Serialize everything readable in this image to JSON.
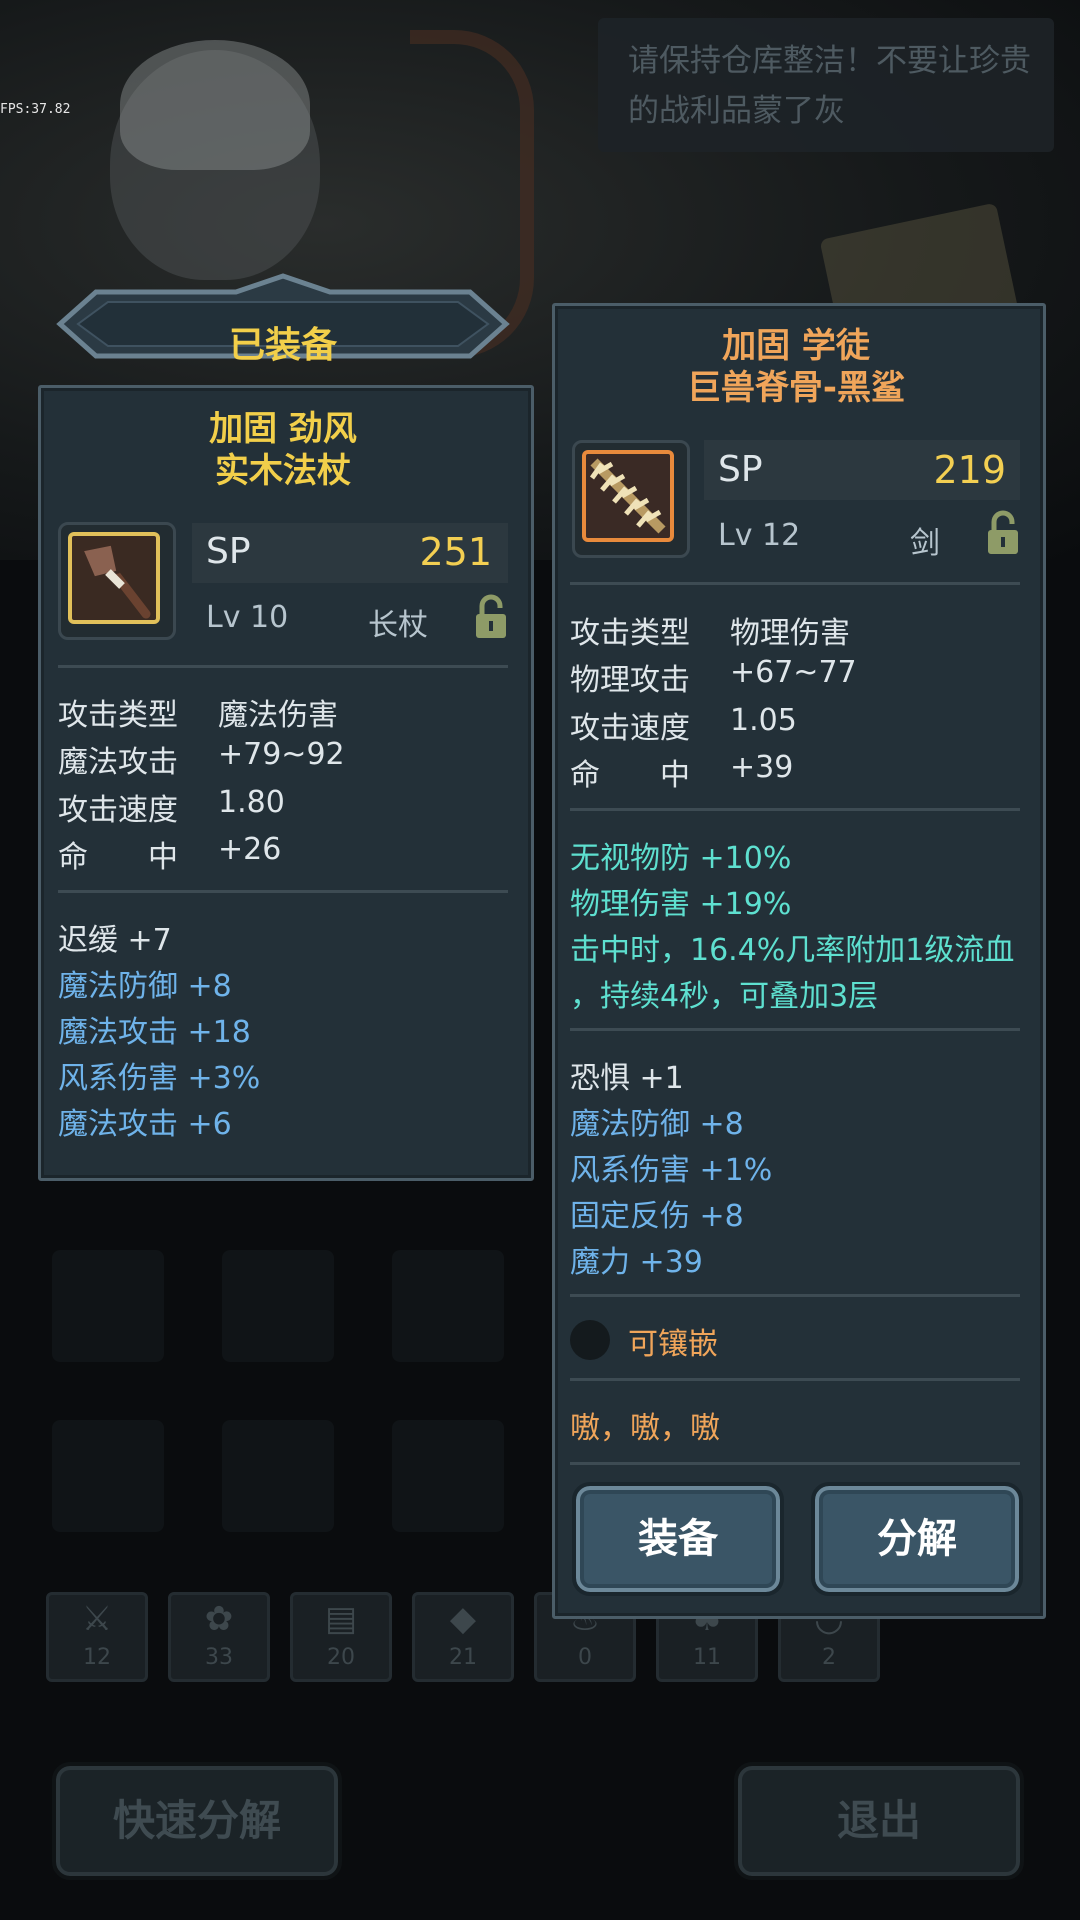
{
  "fps": "FPS:37.82",
  "speech": "请保持仓库整洁！不要让珍贵的战利品蒙了灰",
  "equipped": {
    "banner": "已装备",
    "name_line1": "加固 劲风",
    "name_line2": "实木法杖",
    "sp_label": "SP",
    "sp_value": "251",
    "level": "Lv 10",
    "weapon_type": "长杖",
    "icon": "staff-icon",
    "stats": [
      {
        "label": "攻击类型",
        "value": "魔法伤害"
      },
      {
        "label": "魔法攻击",
        "value": "+79~92"
      },
      {
        "label": "攻击速度",
        "value": "1.80"
      },
      {
        "label": "命　　中",
        "value": "+26"
      }
    ],
    "bonuses": [
      {
        "text": "迟缓 +7",
        "color": "white"
      },
      {
        "text": "魔法防御 +8",
        "color": "blue"
      },
      {
        "text": "魔法攻击 +18",
        "color": "blue"
      },
      {
        "text": "风系伤害 +3%",
        "color": "blue"
      },
      {
        "text": "魔法攻击 +6",
        "color": "blue"
      }
    ]
  },
  "candidate": {
    "name_line1": "加固 学徒",
    "name_line2": "巨兽脊骨-黑鲨",
    "sp_label": "SP",
    "sp_value": "219",
    "level": "Lv 12",
    "weapon_type": "剑",
    "icon": "spine-sword-icon",
    "stats": [
      {
        "label": "攻击类型",
        "value": "物理伤害"
      },
      {
        "label": "物理攻击",
        "value": "+67~77"
      },
      {
        "label": "攻击速度",
        "value": "1.05"
      },
      {
        "label": "命　　中",
        "value": "+39"
      }
    ],
    "special": [
      "无视物防 +10%",
      "物理伤害 +19%",
      "击中时，16.4%几率附加1级流血",
      "，持续4秒，可叠加3层"
    ],
    "bonuses": [
      {
        "text": "恐惧 +1",
        "color": "white"
      },
      {
        "text": "魔法防御 +8",
        "color": "blue"
      },
      {
        "text": "风系伤害 +1%",
        "color": "blue"
      },
      {
        "text": "固定反伤 +8",
        "color": "blue"
      },
      {
        "text": "魔力 +39",
        "color": "blue"
      }
    ],
    "socket_label": "可镶嵌",
    "flavor": "嗷，嗷，嗷",
    "equip_button": "装备",
    "dismantle_button": "分解"
  },
  "tabs": [
    {
      "icon": "weapon-icon",
      "count": "12"
    },
    {
      "icon": "paw-icon",
      "count": "33"
    },
    {
      "icon": "book-icon",
      "count": "20"
    },
    {
      "icon": "gem-icon",
      "count": "21"
    },
    {
      "icon": "potion-icon",
      "count": "0"
    },
    {
      "icon": "leaf-icon",
      "count": "11"
    },
    {
      "icon": "bowl-icon",
      "count": "2"
    }
  ],
  "quick_dismantle": "快速分解",
  "exit": "退出",
  "colors": {
    "gold": "#f2cf4a",
    "orange": "#f0a55a",
    "blue": "#6fb3ea",
    "teal": "#5ee0d0",
    "panel": "#233038"
  }
}
